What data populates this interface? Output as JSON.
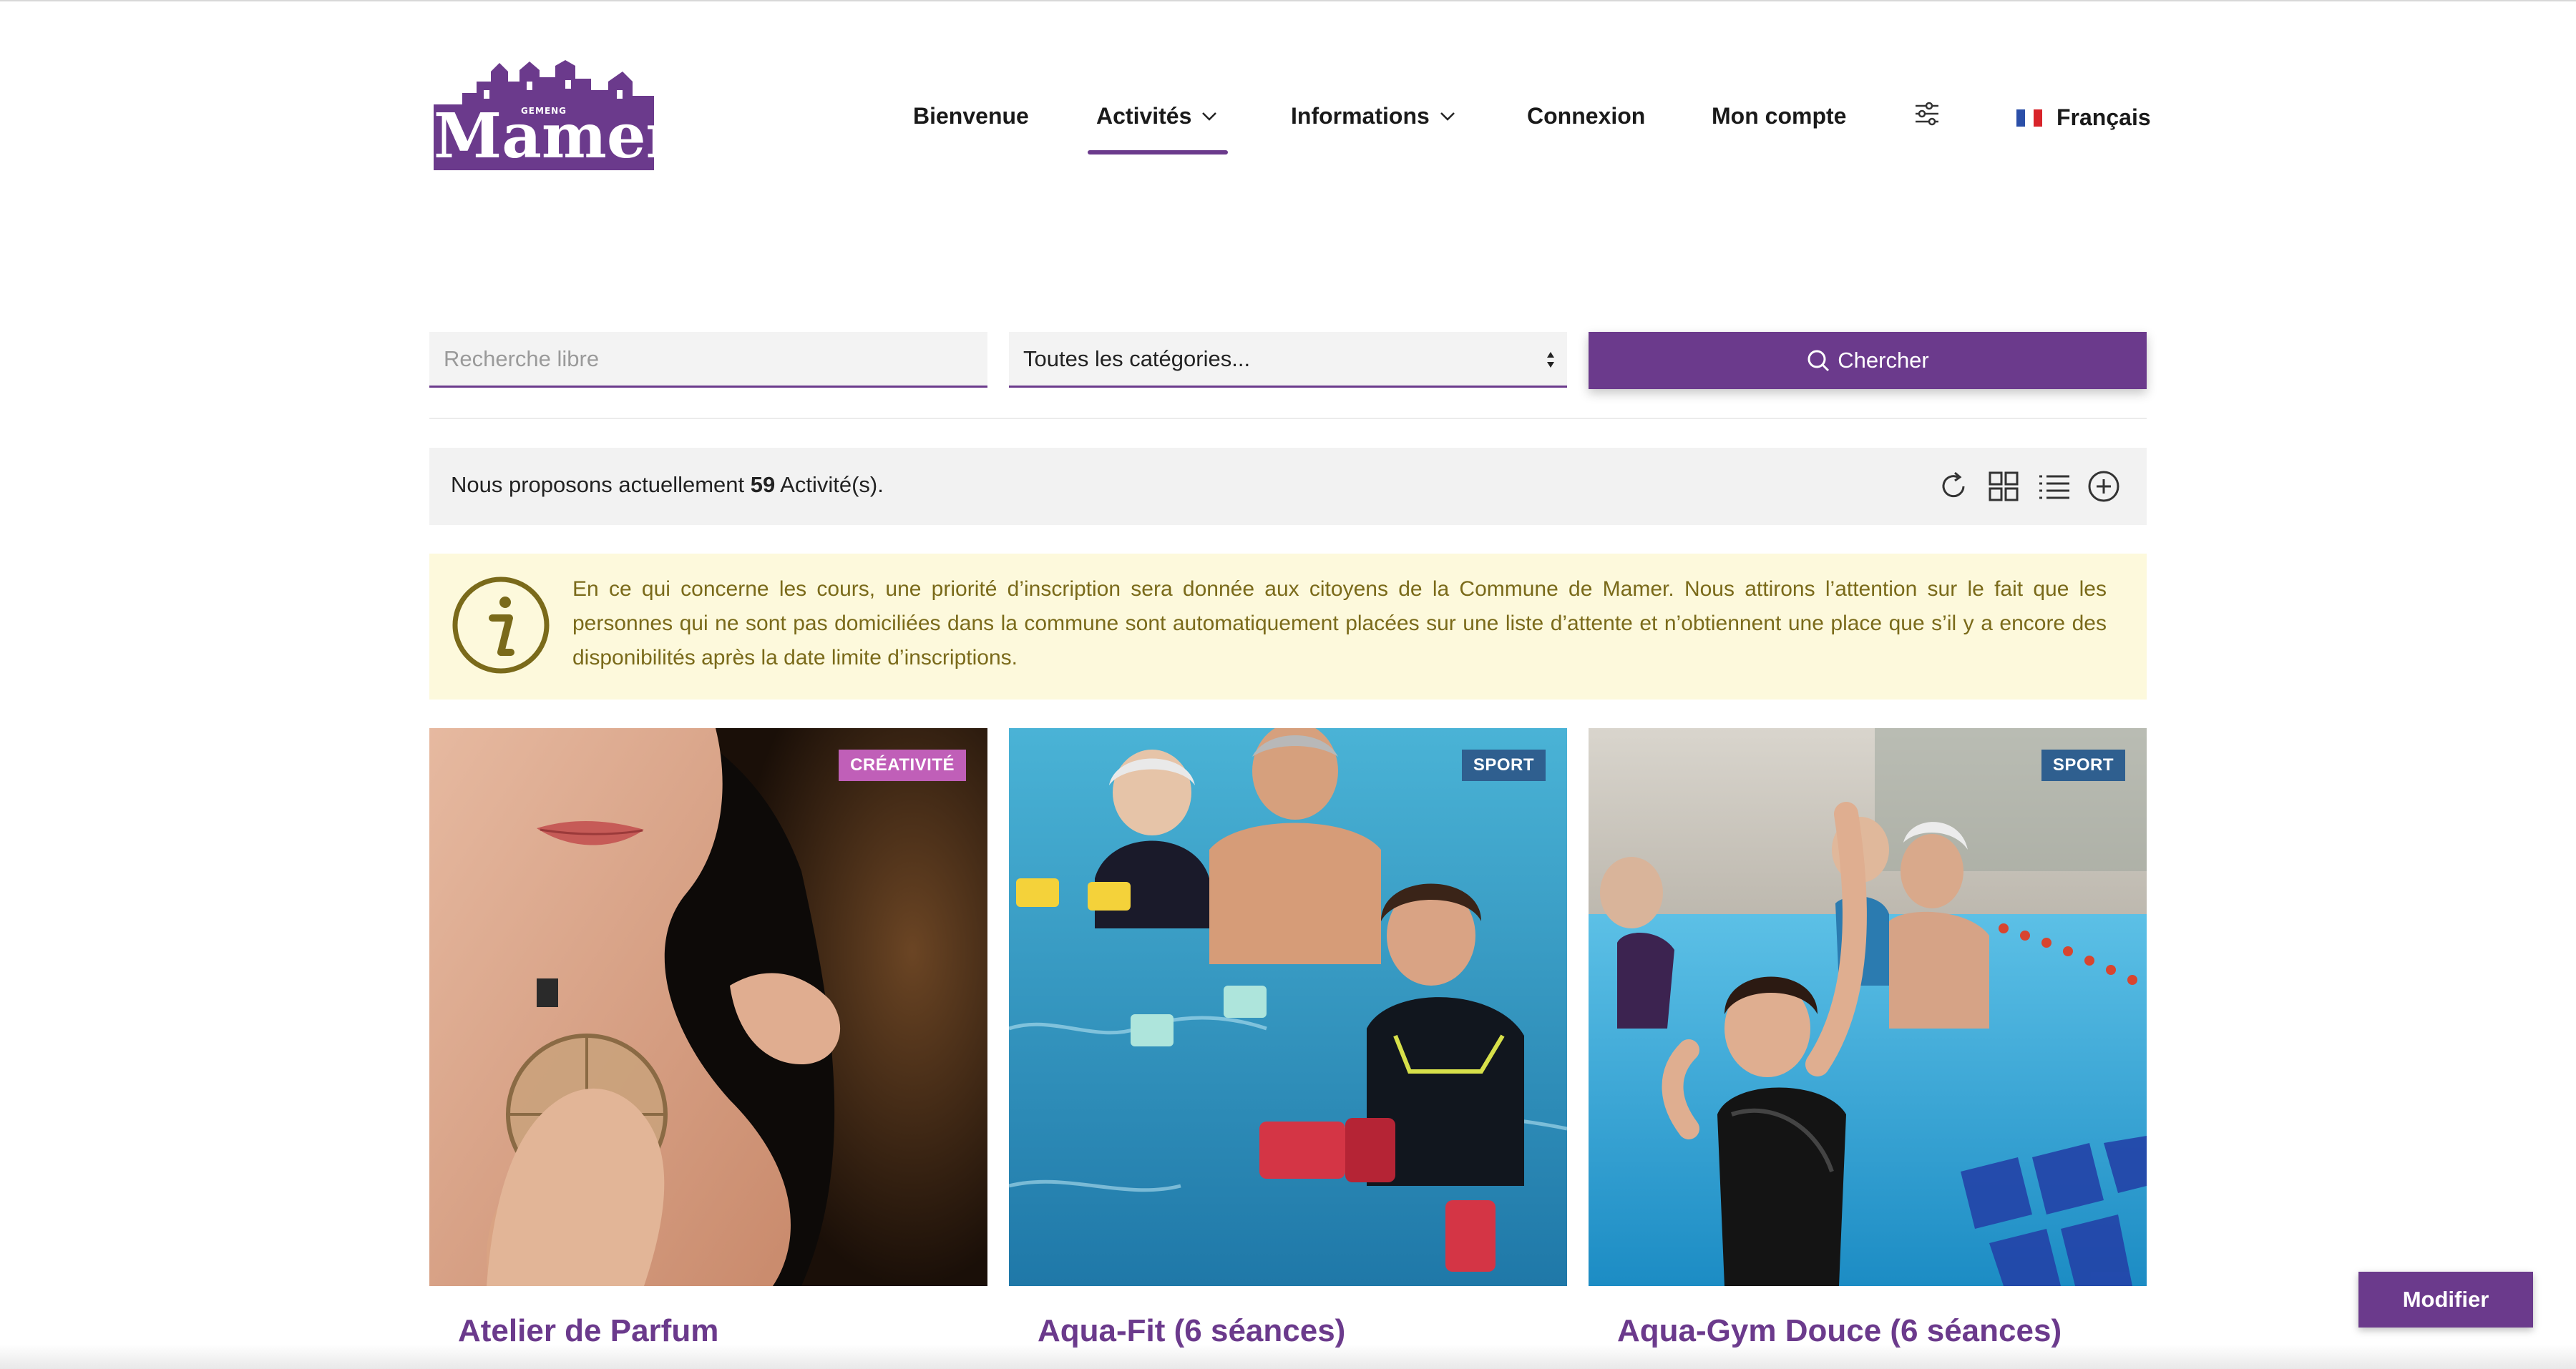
{
  "brand": {
    "logo_small": "GEMENG",
    "logo_name": "Mamer",
    "accent": "#6b3a8c"
  },
  "nav": {
    "items": [
      {
        "label": "Bienvenue"
      },
      {
        "label": "Activités",
        "active": true
      },
      {
        "label": "Informations"
      },
      {
        "label": "Connexion"
      },
      {
        "label": "Mon compte"
      }
    ],
    "settings_icon": "sliders-icon",
    "language": "Français"
  },
  "search": {
    "placeholder": "Recherche libre",
    "category_value": "Toutes les catégories...",
    "button_label": "Chercher"
  },
  "results": {
    "prefix": "Nous proposons actuellement",
    "count": "59",
    "suffix": "Activité(s).",
    "tools": [
      "refresh-icon",
      "grid-view-icon",
      "list-view-icon",
      "add-icon"
    ]
  },
  "notice": {
    "text": "En ce qui concerne les cours, une priorité d’inscription sera donnée aux citoyens de la Commune de Mamer. Nous attirons l’attention sur le fait que les personnes qui ne sont pas domiciliées dans la commune sont automatiquement placées sur une liste d’attente et n’obtiennent une place que s’il y a encore des disponibilités après la date limite d’inscriptions."
  },
  "cards": [
    {
      "title": "Atelier de Parfum",
      "badge": "CRÉATIVITÉ",
      "badge_color": "#c05fb8"
    },
    {
      "title": "Aqua-Fit (6 séances)",
      "badge": "SPORT",
      "badge_color": "#2f5f8f"
    },
    {
      "title": "Aqua-Gym Douce (6 séances)",
      "badge": "SPORT",
      "badge_color": "#2f5f8f"
    }
  ],
  "footer_button": {
    "label": "Modifier"
  }
}
